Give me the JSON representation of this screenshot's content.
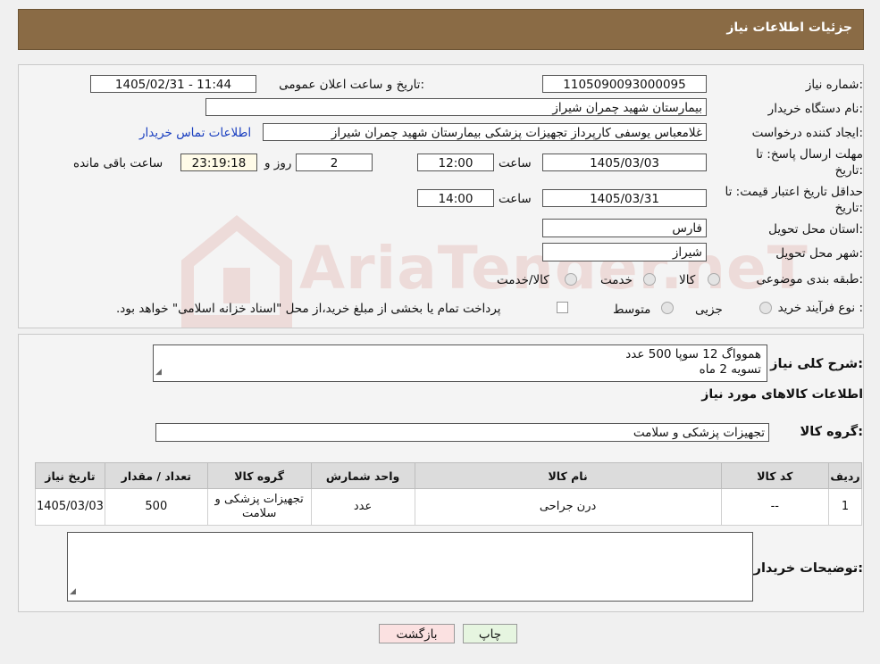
{
  "header": {
    "title": "جزئیات اطلاعات نیاز"
  },
  "form": {
    "need_number_label": "شماره نیاز:",
    "need_number": "1105090093000095",
    "announce_label": "تاریخ و ساعت اعلان عمومی:",
    "announce_value": "1405/02/31 - 11:44",
    "buyer_org_label": "نام دستگاه خریدار:",
    "buyer_org": "بیمارستان شهید چمران شیراز",
    "requester_label": "ایجاد کننده درخواست:",
    "requester": "غلامعباس  یوسفی کارپرداز تجهیزات پزشکی بیمارستان شهید چمران شیراز",
    "contact_link": "اطلاعات تماس خریدار",
    "deadline_label_1": "مهلت ارسال پاسخ: تا",
    "deadline_label_2": "تاریخ:",
    "deadline_date": "1405/03/03",
    "time_label": "ساعت",
    "deadline_time": "12:00",
    "days": "2",
    "days_label": "روز و",
    "remaining": "23:19:18",
    "remaining_label": "ساعت باقی مانده",
    "validity_label_1": "حداقل تاریخ اعتبار قیمت: تا",
    "validity_label_2": "تاریخ:",
    "validity_date": "1405/03/31",
    "validity_time": "14:00",
    "province_label": "استان محل تحویل:",
    "province": "فارس",
    "city_label": "شهر محل تحویل:",
    "city": "شیراز",
    "category_label": "طبقه بندی موضوعی:",
    "cat_goods": "کالا",
    "cat_service": "خدمت",
    "cat_both": "کالا/خدمت",
    "process_label": "نوع فرآیند خرید :",
    "proc_minor": "جزیی",
    "proc_medium": "متوسط",
    "payment_note": "پرداخت تمام یا بخشی از مبلغ خرید،از محل \"اسناد خزانه اسلامی\" خواهد بود."
  },
  "details": {
    "summary_label": "شرح کلی نیاز:",
    "summary_line1": "هموواگ 12 سوپا 500 عدد",
    "summary_line2": "تسویه  2 ماه",
    "goods_info_title": "اطلاعات کالاهای مورد نیاز",
    "goods_group_label": "گروه کالا:",
    "goods_group": "تجهیزات پزشکی و سلامت",
    "table": {
      "headers": [
        "ردیف",
        "کد کالا",
        "نام کالا",
        "واحد شمارش",
        "گروه کالا",
        "تعداد / مقدار",
        "تاریخ نیاز"
      ],
      "row": [
        "1",
        "--",
        "درن جراحی",
        "عدد",
        "تجهیزات پزشکی و سلامت",
        "500",
        "1405/03/03"
      ]
    },
    "buyer_notes_label": "توضیحات خریدار:"
  },
  "buttons": {
    "print": "چاپ",
    "back": "بازگشت"
  },
  "watermark": {
    "text": "AriaTender.neT"
  },
  "colors": {
    "header_bg": "#8a6b45",
    "link": "#1a3fc0",
    "print_bg": "#e6f5e0",
    "back_bg": "#fbe1e1"
  }
}
